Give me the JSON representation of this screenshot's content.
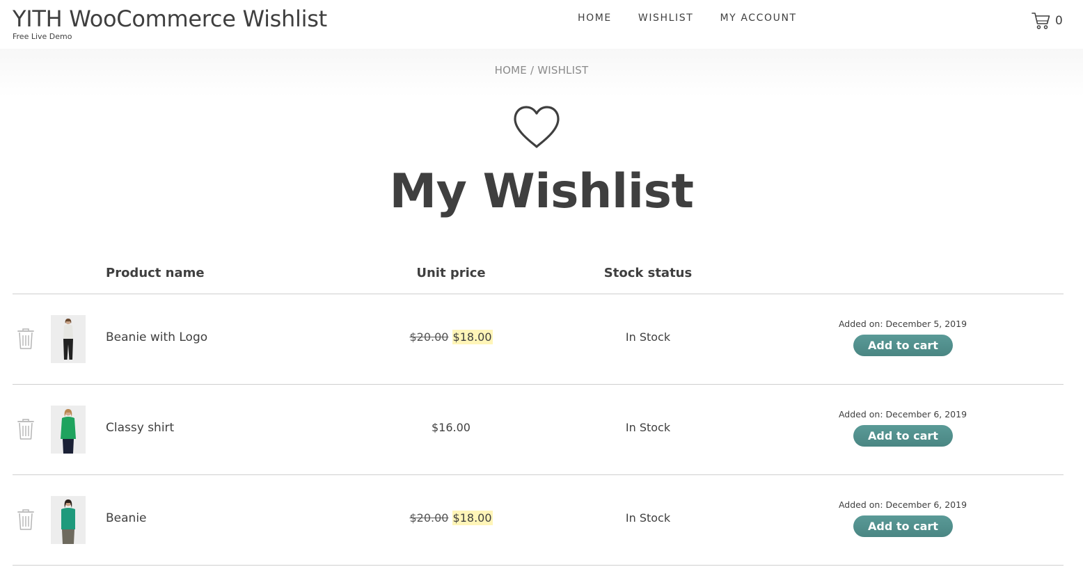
{
  "header": {
    "site_title": "YITH WooCommerce Wishlist",
    "tagline": "Free Live Demo",
    "nav": [
      "HOME",
      "WISHLIST",
      "MY ACCOUNT"
    ],
    "cart_count": "0",
    "cart_icon": "cart-icon"
  },
  "breadcrumb": {
    "home": "HOME",
    "separator": " / ",
    "current": "WISHLIST"
  },
  "page": {
    "icon": "heart-outline-icon",
    "title": "My Wishlist"
  },
  "table": {
    "headers": {
      "product_name": "Product name",
      "unit_price": "Unit price",
      "stock_status": "Stock status"
    },
    "rows": [
      {
        "name": "Beanie with Logo",
        "regular_price": "$20.00",
        "sale_price": "$18.00",
        "price": "",
        "stock": "In Stock",
        "added": "Added on: December 5, 2019",
        "button": "Add to cart",
        "shirt_color": "#e6e6e2",
        "pants_color": "#222222"
      },
      {
        "name": "Classy shirt",
        "regular_price": "",
        "sale_price": "",
        "price": "$16.00",
        "stock": "In Stock",
        "added": "Added on: December 6, 2019",
        "button": "Add to cart",
        "shirt_color": "#1fa35e",
        "pants_color": "#1b2136"
      },
      {
        "name": "Beanie",
        "regular_price": "$20.00",
        "sale_price": "$18.00",
        "price": "",
        "stock": "In Stock",
        "added": "Added on: December 6, 2019",
        "button": "Add to cart",
        "shirt_color": "#1f9a7c",
        "pants_color": "#6e6a5e"
      }
    ]
  },
  "colors": {
    "text": "#3f3f3f",
    "button": "#4f8f8c",
    "sale_highlight": "#fff5b8",
    "border": "#cfcfcf"
  }
}
